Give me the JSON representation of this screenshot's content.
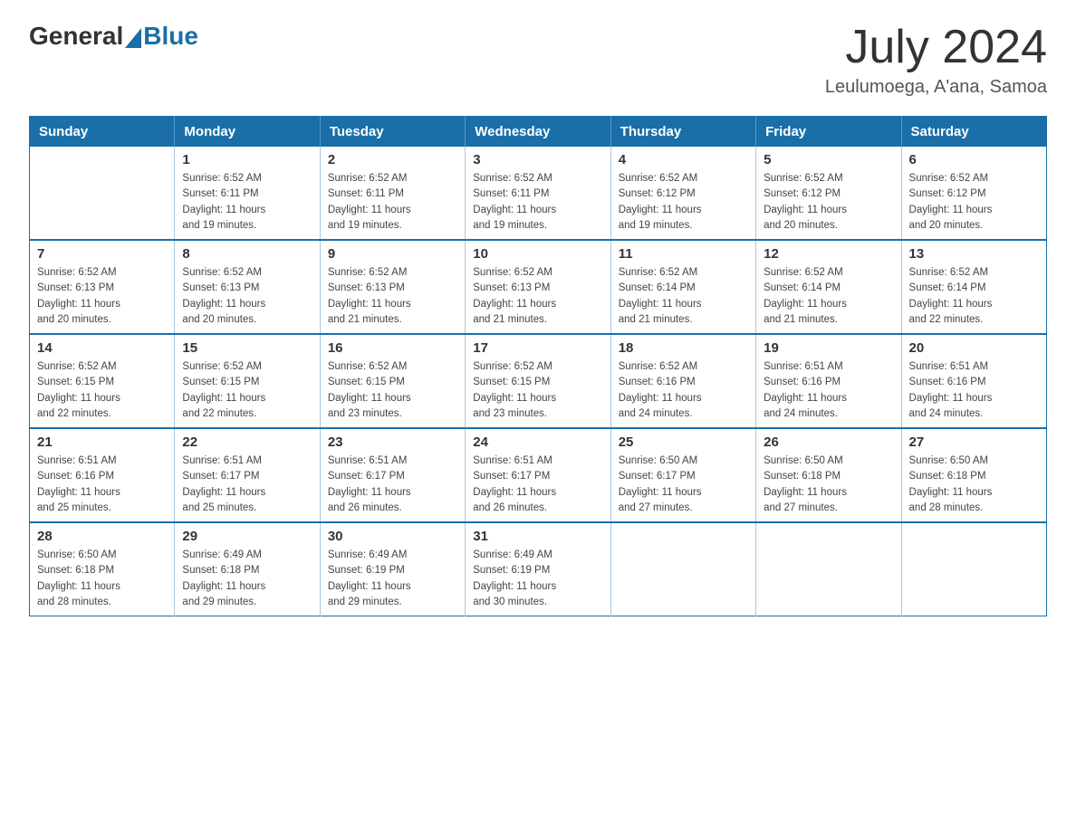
{
  "logo": {
    "general": "General",
    "blue": "Blue"
  },
  "title": "July 2024",
  "location": "Leulumoega, A'ana, Samoa",
  "weekdays": [
    "Sunday",
    "Monday",
    "Tuesday",
    "Wednesday",
    "Thursday",
    "Friday",
    "Saturday"
  ],
  "weeks": [
    [
      {
        "day": "",
        "info": ""
      },
      {
        "day": "1",
        "info": "Sunrise: 6:52 AM\nSunset: 6:11 PM\nDaylight: 11 hours\nand 19 minutes."
      },
      {
        "day": "2",
        "info": "Sunrise: 6:52 AM\nSunset: 6:11 PM\nDaylight: 11 hours\nand 19 minutes."
      },
      {
        "day": "3",
        "info": "Sunrise: 6:52 AM\nSunset: 6:11 PM\nDaylight: 11 hours\nand 19 minutes."
      },
      {
        "day": "4",
        "info": "Sunrise: 6:52 AM\nSunset: 6:12 PM\nDaylight: 11 hours\nand 19 minutes."
      },
      {
        "day": "5",
        "info": "Sunrise: 6:52 AM\nSunset: 6:12 PM\nDaylight: 11 hours\nand 20 minutes."
      },
      {
        "day": "6",
        "info": "Sunrise: 6:52 AM\nSunset: 6:12 PM\nDaylight: 11 hours\nand 20 minutes."
      }
    ],
    [
      {
        "day": "7",
        "info": "Sunrise: 6:52 AM\nSunset: 6:13 PM\nDaylight: 11 hours\nand 20 minutes."
      },
      {
        "day": "8",
        "info": "Sunrise: 6:52 AM\nSunset: 6:13 PM\nDaylight: 11 hours\nand 20 minutes."
      },
      {
        "day": "9",
        "info": "Sunrise: 6:52 AM\nSunset: 6:13 PM\nDaylight: 11 hours\nand 21 minutes."
      },
      {
        "day": "10",
        "info": "Sunrise: 6:52 AM\nSunset: 6:13 PM\nDaylight: 11 hours\nand 21 minutes."
      },
      {
        "day": "11",
        "info": "Sunrise: 6:52 AM\nSunset: 6:14 PM\nDaylight: 11 hours\nand 21 minutes."
      },
      {
        "day": "12",
        "info": "Sunrise: 6:52 AM\nSunset: 6:14 PM\nDaylight: 11 hours\nand 21 minutes."
      },
      {
        "day": "13",
        "info": "Sunrise: 6:52 AM\nSunset: 6:14 PM\nDaylight: 11 hours\nand 22 minutes."
      }
    ],
    [
      {
        "day": "14",
        "info": "Sunrise: 6:52 AM\nSunset: 6:15 PM\nDaylight: 11 hours\nand 22 minutes."
      },
      {
        "day": "15",
        "info": "Sunrise: 6:52 AM\nSunset: 6:15 PM\nDaylight: 11 hours\nand 22 minutes."
      },
      {
        "day": "16",
        "info": "Sunrise: 6:52 AM\nSunset: 6:15 PM\nDaylight: 11 hours\nand 23 minutes."
      },
      {
        "day": "17",
        "info": "Sunrise: 6:52 AM\nSunset: 6:15 PM\nDaylight: 11 hours\nand 23 minutes."
      },
      {
        "day": "18",
        "info": "Sunrise: 6:52 AM\nSunset: 6:16 PM\nDaylight: 11 hours\nand 24 minutes."
      },
      {
        "day": "19",
        "info": "Sunrise: 6:51 AM\nSunset: 6:16 PM\nDaylight: 11 hours\nand 24 minutes."
      },
      {
        "day": "20",
        "info": "Sunrise: 6:51 AM\nSunset: 6:16 PM\nDaylight: 11 hours\nand 24 minutes."
      }
    ],
    [
      {
        "day": "21",
        "info": "Sunrise: 6:51 AM\nSunset: 6:16 PM\nDaylight: 11 hours\nand 25 minutes."
      },
      {
        "day": "22",
        "info": "Sunrise: 6:51 AM\nSunset: 6:17 PM\nDaylight: 11 hours\nand 25 minutes."
      },
      {
        "day": "23",
        "info": "Sunrise: 6:51 AM\nSunset: 6:17 PM\nDaylight: 11 hours\nand 26 minutes."
      },
      {
        "day": "24",
        "info": "Sunrise: 6:51 AM\nSunset: 6:17 PM\nDaylight: 11 hours\nand 26 minutes."
      },
      {
        "day": "25",
        "info": "Sunrise: 6:50 AM\nSunset: 6:17 PM\nDaylight: 11 hours\nand 27 minutes."
      },
      {
        "day": "26",
        "info": "Sunrise: 6:50 AM\nSunset: 6:18 PM\nDaylight: 11 hours\nand 27 minutes."
      },
      {
        "day": "27",
        "info": "Sunrise: 6:50 AM\nSunset: 6:18 PM\nDaylight: 11 hours\nand 28 minutes."
      }
    ],
    [
      {
        "day": "28",
        "info": "Sunrise: 6:50 AM\nSunset: 6:18 PM\nDaylight: 11 hours\nand 28 minutes."
      },
      {
        "day": "29",
        "info": "Sunrise: 6:49 AM\nSunset: 6:18 PM\nDaylight: 11 hours\nand 29 minutes."
      },
      {
        "day": "30",
        "info": "Sunrise: 6:49 AM\nSunset: 6:19 PM\nDaylight: 11 hours\nand 29 minutes."
      },
      {
        "day": "31",
        "info": "Sunrise: 6:49 AM\nSunset: 6:19 PM\nDaylight: 11 hours\nand 30 minutes."
      },
      {
        "day": "",
        "info": ""
      },
      {
        "day": "",
        "info": ""
      },
      {
        "day": "",
        "info": ""
      }
    ]
  ]
}
